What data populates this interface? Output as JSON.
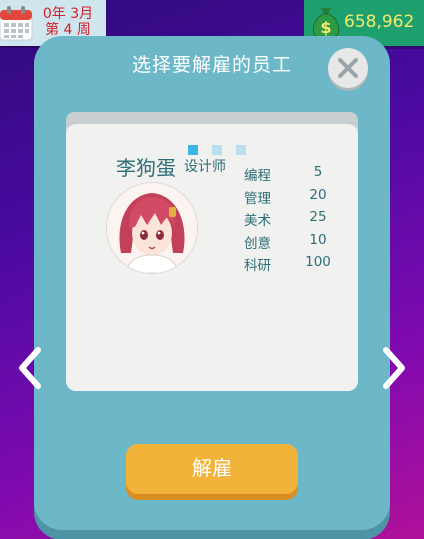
{
  "top_bar": {
    "calendar": {
      "icon": "calendar-icon",
      "line1": "0年 3月",
      "line2": "第 4 周"
    },
    "money": {
      "icon": "money-bag-icon",
      "amount": "658,962"
    }
  },
  "dialog": {
    "title": "选择要解雇的员工",
    "close_icon": "close-icon",
    "pager_dots": [
      {
        "active": true
      },
      {
        "active": false
      },
      {
        "active": false
      }
    ],
    "employee": {
      "name": "李狗蛋",
      "role": "设计师",
      "stats": [
        {
          "label": "编程",
          "value": "5"
        },
        {
          "label": "管理",
          "value": "20"
        },
        {
          "label": "美术",
          "value": "25"
        },
        {
          "label": "创意",
          "value": "10"
        },
        {
          "label": "科研",
          "value": "100"
        }
      ]
    },
    "fire_button": "解雇",
    "prev_icon": "chevron-left-icon",
    "next_icon": "chevron-right-icon"
  },
  "colors": {
    "dialog_bg": "#6cb8c8",
    "card_bg": "#f1f1ef",
    "accent_button": "#f2b33a",
    "money_bg": "#1ea06e",
    "date_text": "#d0202a",
    "dot_active": "#3bb6e6",
    "dot_inactive": "#b8dff0"
  }
}
